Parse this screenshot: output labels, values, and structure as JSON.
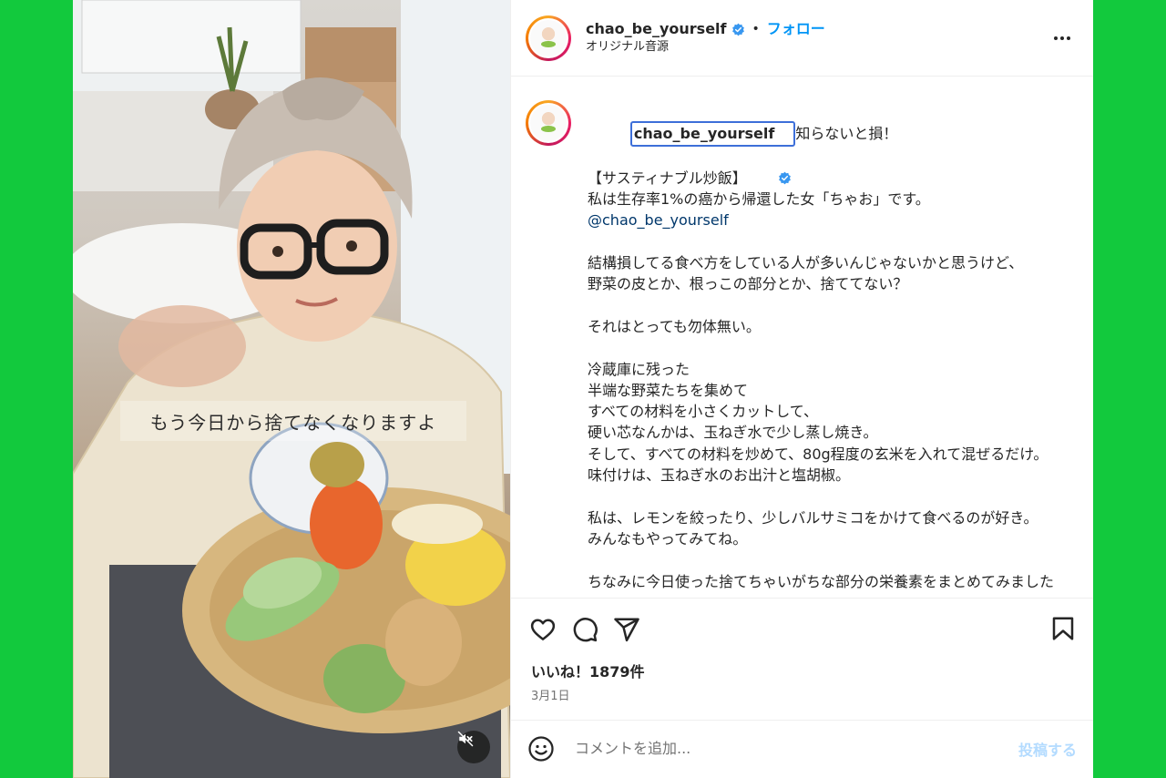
{
  "colors": {
    "background": "#12c93d",
    "accent": "#0095f6",
    "verified": "#3897f0"
  },
  "media": {
    "overlay_text": "もう今日から捨てなくなりますよ",
    "mute_icon": "speaker-muted-icon"
  },
  "header": {
    "username": "chao_be_yourself",
    "separator": "•",
    "follow_label": "フォロー",
    "audio_label": "オリジナル音源",
    "more_icon": "more-horizontal-icon"
  },
  "caption": {
    "username": "chao_be_yourself",
    "first_line": "知らないと損！",
    "line_2": "【サスティナブル炒飯】",
    "line_3": "私は生存率1%の癌から帰還した女「ちゃお」です。",
    "mention": "@chao_be_yourself",
    "paragraph_1": "結構損してる食べ方をしている人が多いんじゃないかと思うけど、\n野菜の皮とか、根っこの部分とか、捨ててない？",
    "paragraph_2": "それはとっても勿体無い。",
    "paragraph_3": "冷蔵庫に残った\n半端な野菜たちを集めて\nすべての材料を小さくカットして、\n硬い芯なんかは、玉ねぎ水で少し蒸し焼き。\nそして、すべての材料を炒めて、80g程度の玄米を入れて混ぜるだけ。\n味付けは、玉ねぎ水のお出汁と塩胡椒。",
    "paragraph_4": "私は、レモンを絞ったり、少しバルサミコをかけて食べるのが好き。\nみんなもやってみてね。",
    "paragraph_5": "ちなみに今日使った捨てちゃいがちな部分の栄養素をまとめてみました"
  },
  "actions": {
    "like_icon": "heart-icon",
    "comment_icon": "comment-icon",
    "share_icon": "share-icon",
    "save_icon": "bookmark-icon"
  },
  "likes_text": "いいね！1879件",
  "date_text": "3月1日",
  "comment": {
    "emoji_icon": "emoji-icon",
    "placeholder": "コメントを追加...",
    "post_label": "投稿する"
  }
}
